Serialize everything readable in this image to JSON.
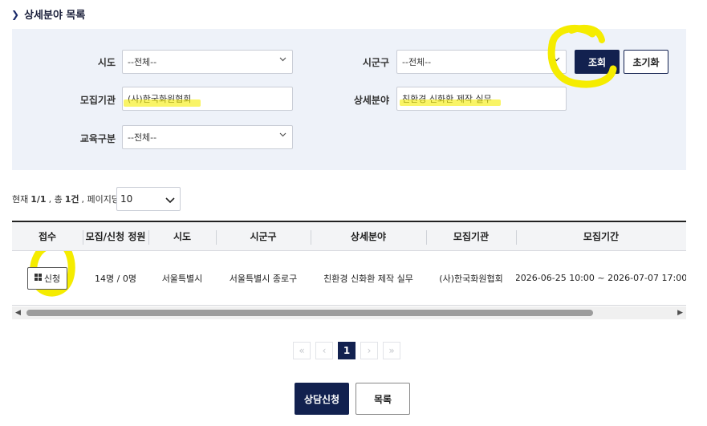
{
  "section_title": "상세분야 목록",
  "search": {
    "sido_label": "시도",
    "sido_value": "--전체--",
    "sigungu_label": "시군구",
    "sigungu_value": "--전체--",
    "org_label": "모집기관",
    "org_value": "(사)한국화원협회",
    "field_label": "상세분야",
    "field_value": "친환경 신화환 제작 실무",
    "edu_label": "교육구분",
    "edu_value": "--전체--",
    "search_button": "조회",
    "reset_button": "초기화"
  },
  "summary": {
    "prefix": "현재",
    "page": "1/1",
    "total_prefix": ", 총",
    "total": "1건",
    "per_page_label": ", 페이지당 :",
    "per_page_value": "10"
  },
  "table": {
    "headers": [
      "접수",
      "모집/신청 정원",
      "시도",
      "시군구",
      "상세분야",
      "모집기관",
      "모집기간"
    ],
    "rows": [
      {
        "apply": "신청",
        "capacity": "14명 / 0명",
        "sido": "서울특별시",
        "sigungu": "서울특별시 종로구",
        "field": "친환경 신화환 제작 실무",
        "org": "(사)한국화원협회",
        "period": "2026-06-25 10:00 ~ 2026-07-07 17:00"
      }
    ]
  },
  "pagination": {
    "first": "«",
    "prev": "‹",
    "current": "1",
    "next": "›",
    "last": "»"
  },
  "bottom": {
    "consult_button": "상담신청",
    "list_button": "목록"
  },
  "colors": {
    "primary": "#12214f",
    "panel_bg": "#eef2f9",
    "highlight": "#f5ec00"
  }
}
